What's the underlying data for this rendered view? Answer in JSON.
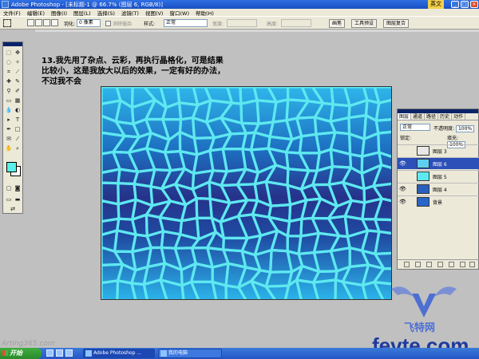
{
  "window": {
    "title": "Adobe Photoshop - [未标题-1 @ 66.7% (图层 6, RGB/8)]",
    "ime_label": "英文"
  },
  "menu": [
    "文件(F)",
    "编辑(E)",
    "图像(I)",
    "图层(L)",
    "选择(S)",
    "滤镜(T)",
    "视图(V)",
    "窗口(W)",
    "帮助(H)"
  ],
  "options_bar": {
    "feather_label": "羽化:",
    "feather_value": "0 像素",
    "antialias_label": "消除锯齿",
    "style_label": "样式:",
    "style_value": "正常",
    "width_label": "宽度:",
    "height_label": "高度:",
    "tabs": [
      "画笔",
      "工具预设",
      "图层复合"
    ]
  },
  "caption": "13.我先用了杂点、云彩，再执行晶格化，可是结果\n比较小，这是我放大以后的效果，一定有好的办法，\n不过我不会",
  "colors": {
    "foreground": "#59f0e8",
    "background": "#ffffff",
    "cell_edge": "#5ee8f0",
    "selected_layer": "#2c4fb8"
  },
  "layers_panel": {
    "tabs": [
      "图层",
      "通道",
      "路径",
      "历史",
      "动作"
    ],
    "blend_mode": "正常",
    "opacity_label": "不透明度:",
    "opacity_value": "100%",
    "lock_label": "锁定:",
    "fill_label": "填充:",
    "fill_value": "100%",
    "layers": [
      {
        "name": "图层 3",
        "visible": false,
        "selected": false,
        "thumb": "#e8e8e8"
      },
      {
        "name": "图层 6",
        "visible": true,
        "selected": true,
        "thumb": "#5ecff0"
      },
      {
        "name": "图层 5",
        "visible": false,
        "selected": false,
        "thumb": "#5ee8f0"
      },
      {
        "name": "图层 4",
        "visible": true,
        "selected": false,
        "thumb": "#2a5fc0"
      },
      {
        "name": "背景",
        "visible": true,
        "selected": false,
        "thumb": "#2a66c8"
      }
    ]
  },
  "status": {
    "watermark": "Arting365.com"
  },
  "taskbar": {
    "start_label": "开始",
    "items": [
      {
        "label": "Adobe Photoshop ...",
        "active": true
      },
      {
        "label": "我的电脑",
        "active": false
      }
    ]
  },
  "brand": {
    "cn": "飞特网",
    "en": "fevte.com"
  }
}
